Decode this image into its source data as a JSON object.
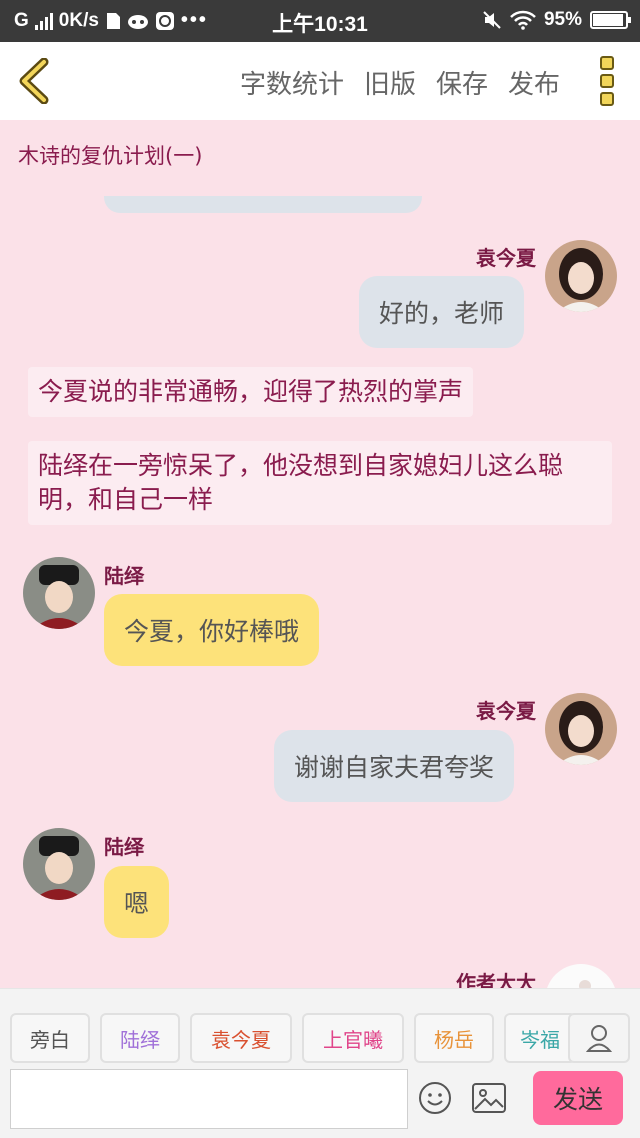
{
  "status_bar": {
    "network": "G",
    "speed": "0K/s",
    "dots": "•••",
    "time": "上午10:31",
    "battery": "95%"
  },
  "toolbar": {
    "actions": [
      "字数统计",
      "旧版",
      "保存",
      "发布"
    ]
  },
  "chapter": {
    "title": "木诗的复仇计划(一)"
  },
  "messages": [
    {
      "type": "dialogue",
      "speaker": "袁今夏",
      "side": "right",
      "text": "好的，老师"
    },
    {
      "type": "narration",
      "text": "今夏说的非常通畅，迎得了热烈的掌声"
    },
    {
      "type": "narration",
      "text": "陆绎在一旁惊呆了，他没想到自家媳妇儿这么聪明，和自己一样"
    },
    {
      "type": "dialogue",
      "speaker": "陆绎",
      "side": "left",
      "text": "今夏，你好棒哦"
    },
    {
      "type": "dialogue",
      "speaker": "袁今夏",
      "side": "right",
      "text": "谢谢自家夫君夸奖"
    },
    {
      "type": "dialogue",
      "speaker": "陆绎",
      "side": "left",
      "text": "嗯"
    },
    {
      "type": "dialogue",
      "speaker": "作者大大",
      "side": "right",
      "text": ""
    }
  ],
  "roles": [
    {
      "label": "旁白",
      "color": "#555555",
      "active": true
    },
    {
      "label": "陆绎",
      "color": "#a070d8",
      "active": false
    },
    {
      "label": "袁今夏",
      "color": "#d9502f",
      "active": false
    },
    {
      "label": "上官曦",
      "color": "#e0458a",
      "active": false
    },
    {
      "label": "杨岳",
      "color": "#e8933a",
      "active": false
    },
    {
      "label": "岑福",
      "color": "#3aa7a7",
      "active": false
    }
  ],
  "composer": {
    "input_value": "",
    "send_label": "发送"
  }
}
